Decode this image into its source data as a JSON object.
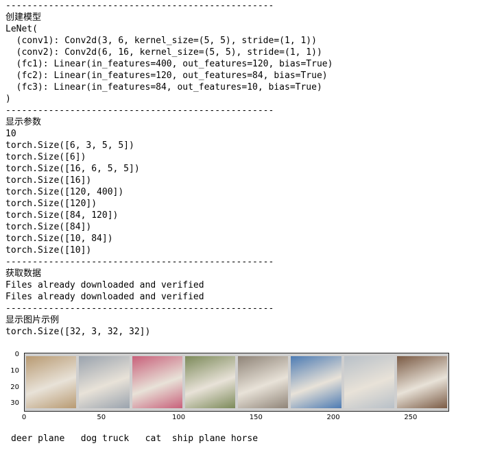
{
  "output_lines": [
    "--------------------------------------------------",
    "创建模型",
    "LeNet(",
    "  (conv1): Conv2d(3, 6, kernel_size=(5, 5), stride=(1, 1))",
    "  (conv2): Conv2d(6, 16, kernel_size=(5, 5), stride=(1, 1))",
    "  (fc1): Linear(in_features=400, out_features=120, bias=True)",
    "  (fc2): Linear(in_features=120, out_features=84, bias=True)",
    "  (fc3): Linear(in_features=84, out_features=10, bias=True)",
    ")",
    "--------------------------------------------------",
    "显示参数",
    "10",
    "torch.Size([6, 3, 5, 5])",
    "torch.Size([6])",
    "torch.Size([16, 6, 5, 5])",
    "torch.Size([16])",
    "torch.Size([120, 400])",
    "torch.Size([120])",
    "torch.Size([84, 120])",
    "torch.Size([84])",
    "torch.Size([10, 84])",
    "torch.Size([10])",
    "--------------------------------------------------",
    "获取数据",
    "Files already downloaded and verified",
    "Files already downloaded and verified",
    "--------------------------------------------------",
    "显示图片示例",
    "torch.Size([32, 3, 32, 32])"
  ],
  "figure": {
    "y_ticks": [
      "0",
      "10",
      "20",
      "30"
    ],
    "x_ticks": [
      "0",
      "50",
      "100",
      "150",
      "200",
      "250"
    ],
    "tiles": [
      {
        "name": "deer",
        "color": "#b89a72"
      },
      {
        "name": "plane",
        "color": "#9aa3ae"
      },
      {
        "name": "dog",
        "color": "#c8607a"
      },
      {
        "name": "truck",
        "color": "#7c8a5a"
      },
      {
        "name": "cat",
        "color": "#8f8478"
      },
      {
        "name": "ship",
        "color": "#4d7bb3"
      },
      {
        "name": "plane",
        "color": "#b8c0c8"
      },
      {
        "name": "horse",
        "color": "#7a5a44"
      }
    ]
  },
  "labels_line": "deer plane   dog truck   cat  ship plane horse"
}
